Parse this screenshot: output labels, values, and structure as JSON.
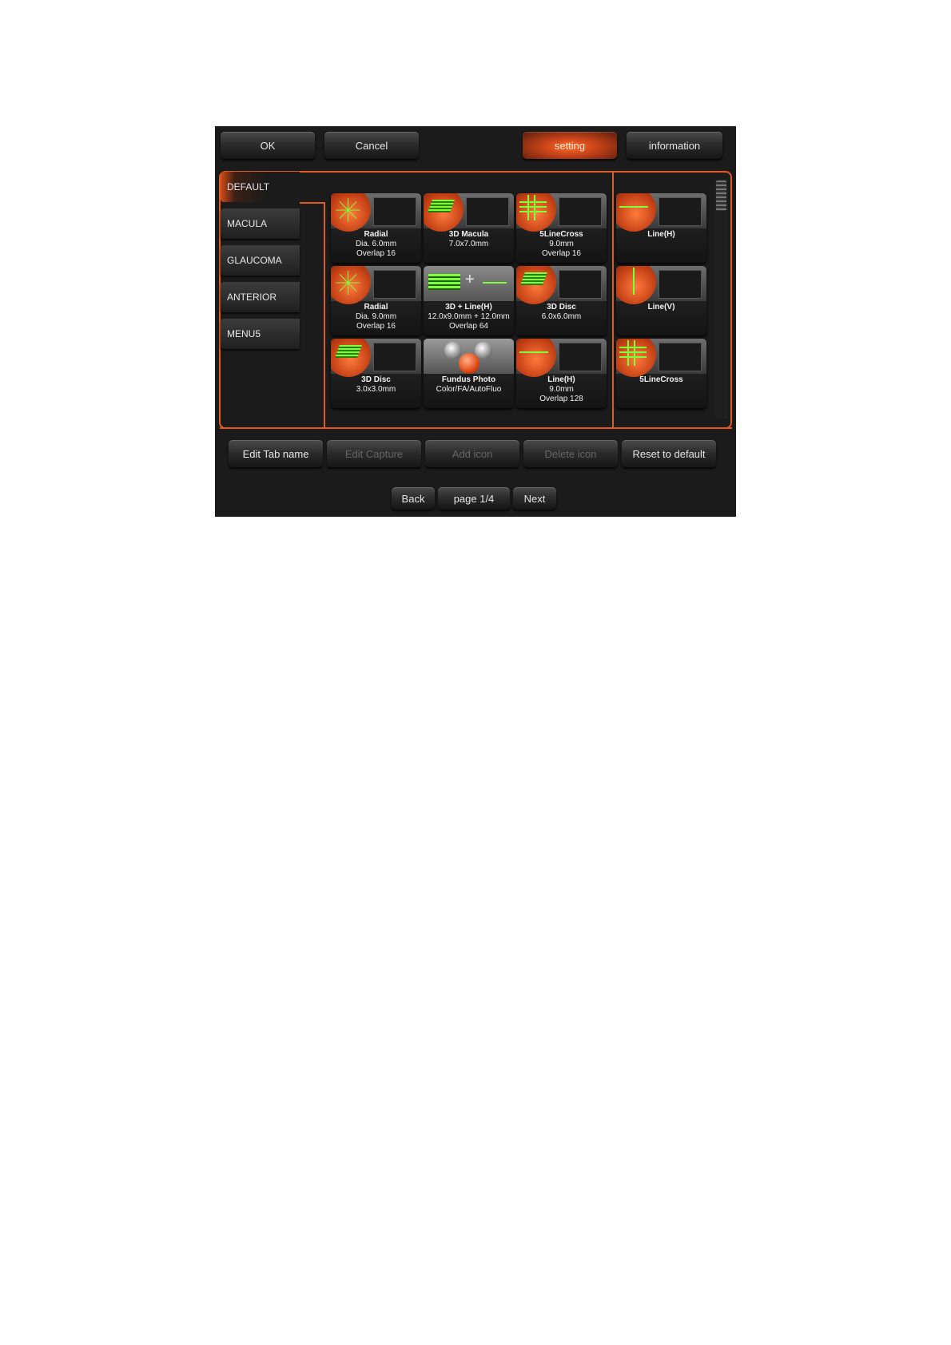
{
  "topbar": {
    "ok": "OK",
    "cancel": "Cancel",
    "setting": "setting",
    "information": "information"
  },
  "tabs": [
    {
      "label": "DEFAULT",
      "active": true
    },
    {
      "label": "MACULA"
    },
    {
      "label": "GLAUCOMA"
    },
    {
      "label": "ANTERIOR"
    },
    {
      "label": "MENU5"
    }
  ],
  "grid": [
    {
      "title": "Radial",
      "lines": [
        "Dia. 6.0mm",
        "Overlap 16"
      ]
    },
    {
      "title": "3D Macula",
      "lines": [
        "7.0x7.0mm",
        ""
      ]
    },
    {
      "title": "5LineCross",
      "lines": [
        "9.0mm",
        "Overlap 16"
      ]
    },
    {
      "title": "Radial",
      "lines": [
        "Dia. 9.0mm",
        "Overlap 16"
      ]
    },
    {
      "title": "3D + Line(H)",
      "lines": [
        "12.0x9.0mm + 12.0mm",
        "Overlap 64"
      ]
    },
    {
      "title": "3D Disc",
      "lines": [
        "6.0x6.0mm",
        ""
      ]
    },
    {
      "title": "3D Disc",
      "lines": [
        "3.0x3.0mm",
        ""
      ]
    },
    {
      "title": "Fundus Photo",
      "lines": [
        "Color/FA/AutoFluo",
        ""
      ]
    },
    {
      "title": "Line(H)",
      "lines": [
        "9.0mm",
        "Overlap 128"
      ]
    }
  ],
  "side": [
    {
      "title": "Line(H)"
    },
    {
      "title": "Line(V)"
    },
    {
      "title": "5LineCross"
    }
  ],
  "actions": {
    "edit_tab_name": "Edit Tab name",
    "edit_capture": "Edit Capture",
    "add_icon": "Add icon",
    "delete_icon": "Delete icon",
    "reset_to_default": "Reset to default"
  },
  "pager": {
    "back": "Back",
    "page": "page 1/4",
    "next": "Next"
  },
  "colors": {
    "accent": "#e05a24",
    "background": "#1b1b1b"
  }
}
